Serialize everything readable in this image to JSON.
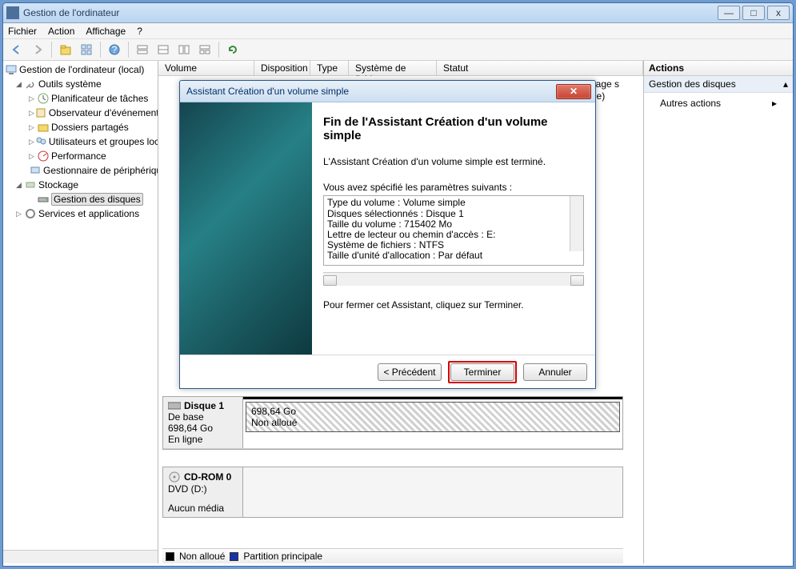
{
  "window": {
    "title": "Gestion de l'ordinateur",
    "controls": {
      "min": "—",
      "max": "□",
      "close": "x"
    }
  },
  "menubar": {
    "file": "Fichier",
    "action": "Action",
    "view": "Affichage",
    "help": "?"
  },
  "tree": {
    "root": "Gestion de l'ordinateur (local)",
    "systools": "Outils système",
    "scheduler": "Planificateur de tâches",
    "eventviewer": "Observateur d'événements",
    "shared": "Dossiers partagés",
    "users": "Utilisateurs et groupes locaux",
    "perf": "Performance",
    "devmgr": "Gestionnaire de périphériques",
    "storage": "Stockage",
    "diskmgmt": "Gestion des disques",
    "services": "Services et applications"
  },
  "volcols": {
    "volume": "Volume",
    "layout": "Disposition",
    "type": "Type",
    "fs": "Système de fichiers",
    "status": "Statut"
  },
  "partial": {
    "a": "ge, Vidage s",
    "b": "rincipale)"
  },
  "disks": {
    "d1_name": "Disque 1",
    "d1_type": "De base",
    "d1_size": "698,64 Go",
    "d1_status": "En ligne",
    "d1_part_size": "698,64 Go",
    "d1_part_status": "Non alloué",
    "cd_name": "CD-ROM 0",
    "cd_type": "DVD (D:)",
    "cd_status": "Aucun média"
  },
  "legend": {
    "unalloc": "Non alloué",
    "primary": "Partition principale"
  },
  "actions": {
    "header": "Actions",
    "diskmgmt": "Gestion des disques",
    "other": "Autres actions"
  },
  "wizard": {
    "title": "Assistant Création d'un volume simple",
    "heading": "Fin de l'Assistant Création d'un volume simple",
    "done": "L'Assistant Création d'un volume simple est terminé.",
    "params_intro": "Vous avez spécifié les paramètres suivants :",
    "summary": {
      "l1": "Type du volume : Volume simple",
      "l2": "Disques sélectionnés : Disque 1",
      "l3": "Taille du volume : 715402 Mo",
      "l4": "Lettre de lecteur ou chemin d'accès : E:",
      "l5": "Système de fichiers : NTFS",
      "l6": "Taille d'unité d'allocation : Par défaut"
    },
    "close_instr": "Pour fermer cet Assistant, cliquez sur Terminer.",
    "btn_prev": "< Précédent",
    "btn_finish": "Terminer",
    "btn_cancel": "Annuler"
  }
}
